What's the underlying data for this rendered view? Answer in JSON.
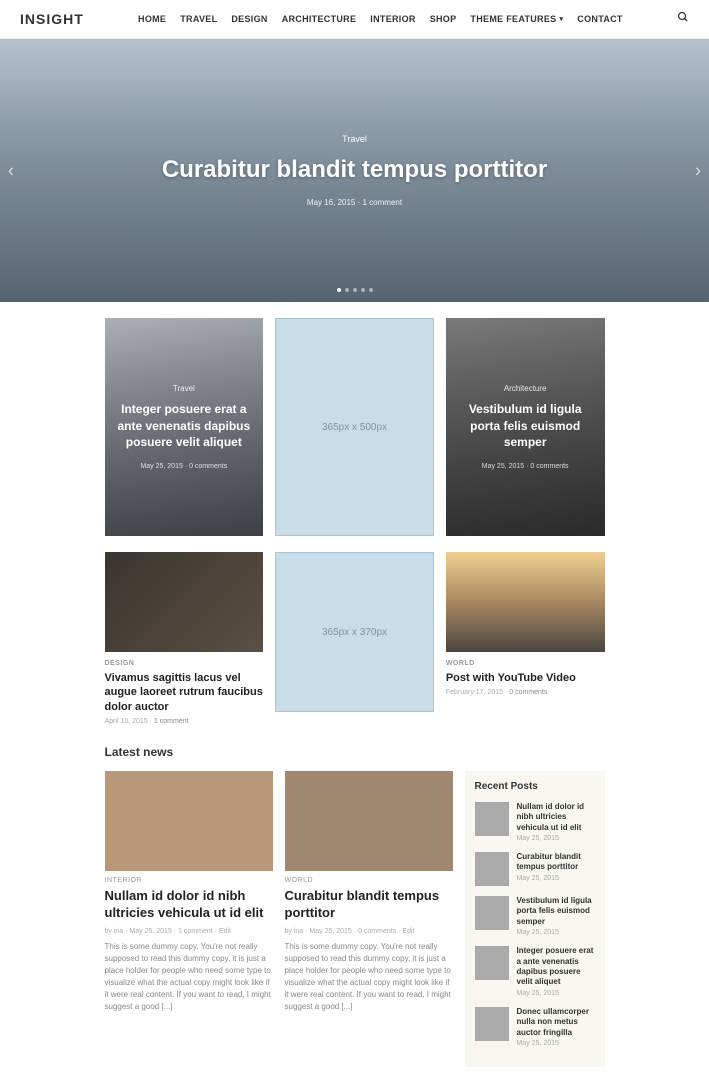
{
  "logo": "INSIGHT",
  "nav": [
    "HOME",
    "TRAVEL",
    "DESIGN",
    "ARCHITECTURE",
    "INTERIOR",
    "SHOP",
    "THEME FEATURES",
    "CONTACT"
  ],
  "hero": {
    "category": "Travel",
    "title": "Curabitur blandit tempus porttitor",
    "date": "May 16, 2015",
    "comments": "1 comment"
  },
  "tiles": [
    {
      "category": "Travel",
      "title": "Integer posuere erat a ante venenatis dapibus posuere velit aliquet",
      "date": "May 25, 2015",
      "comments": "0 comments"
    },
    {
      "placeholder": "365px x 500px"
    },
    {
      "category": "Architecture",
      "title": "Vestibulum id ligula porta felis euismod semper",
      "date": "May 25, 2015",
      "comments": "0 comments"
    }
  ],
  "cards": [
    {
      "category": "DESIGN",
      "title": "Vivamus sagittis lacus vel augue laoreet rutrum faucibus dolor auctor",
      "date": "April 10, 2015",
      "comments": "1 comment"
    },
    {
      "placeholder": "365px x 370px"
    },
    {
      "category": "WORLD",
      "title": "Post with YouTube Video",
      "date": "February 17, 2015",
      "comments": "0 comments"
    }
  ],
  "latest_title": "Latest news",
  "posts": [
    {
      "category": "INTERIOR",
      "title": "Nullam id dolor id nibh ultricies vehicula ut id elit",
      "author": "ina",
      "date": "May 25, 2015",
      "comments": "1 comment",
      "edit": "Edit",
      "excerpt": "This is some dummy copy. You're not really supposed to read this dummy copy, it is just a place holder for people who need some type to visualize what the actual copy might look like if it were real content. If you want to read, I might suggest a good [...]"
    },
    {
      "category": "WORLD",
      "title": "Curabitur blandit tempus porttitor",
      "author": "ina",
      "date": "May 25, 2015",
      "comments": "0 comments",
      "edit": "Edit",
      "excerpt": "This is some dummy copy. You're not really supposed to read this dummy copy, it is just a place holder for people who need some type to visualize what the actual copy might look like if it were real content. If you want to read, I might suggest a good [...]"
    }
  ],
  "sidebar": {
    "title": "Recent Posts",
    "items": [
      {
        "title": "Nullam id dolor id nibh ultricies vehicula ut id elit",
        "date": "May 25, 2015"
      },
      {
        "title": "Curabitur blandit tempus porttitor",
        "date": "May 25, 2015"
      },
      {
        "title": "Vestibulum id ligula porta felis euismod semper",
        "date": "May 25, 2015"
      },
      {
        "title": "Integer posuere erat a ante venenatis dapibus posuere velit aliquet",
        "date": "May 25, 2015"
      },
      {
        "title": "Donec ullamcorper nulla non metus auctor fringilla",
        "date": "May 25, 2015"
      }
    ]
  }
}
